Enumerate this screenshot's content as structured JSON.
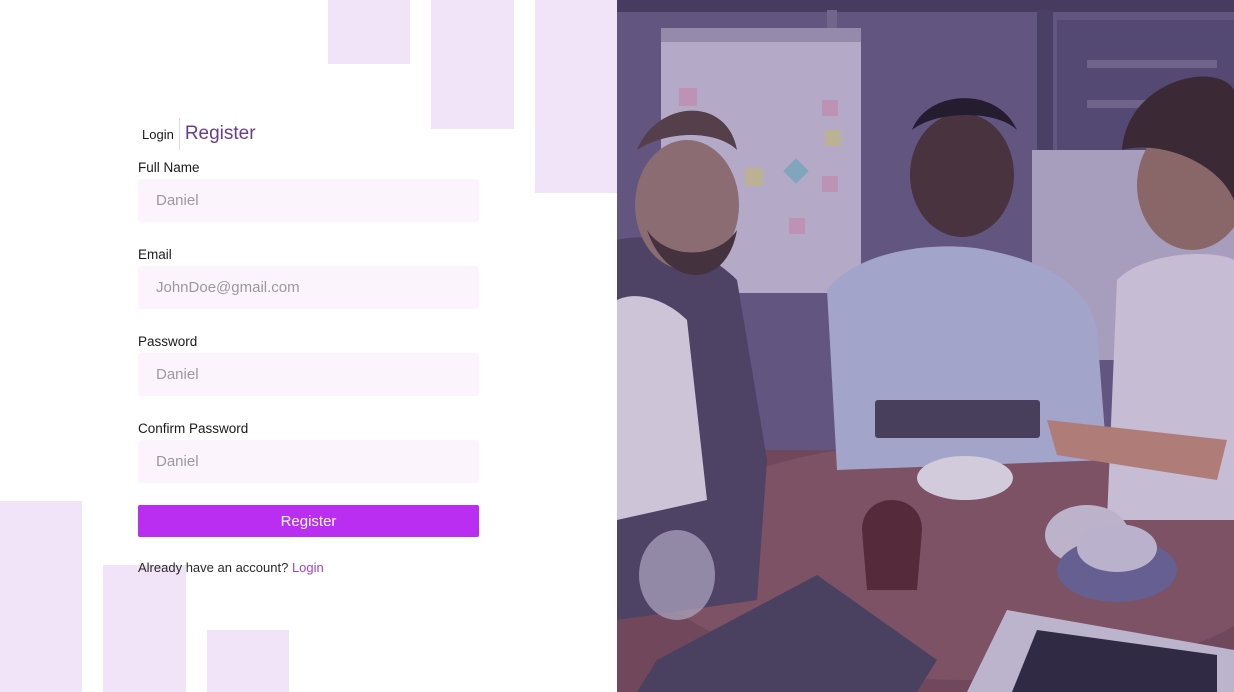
{
  "tabs": {
    "login": "Login",
    "register": "Register"
  },
  "form": {
    "fields": [
      {
        "label": "Full Name",
        "placeholder": "Daniel"
      },
      {
        "label": "Email",
        "placeholder": "JohnDoe@gmail.com"
      },
      {
        "label": "Password",
        "placeholder": "Daniel"
      },
      {
        "label": "Confirm Password",
        "placeholder": "Daniel"
      }
    ],
    "submit_label": "Register"
  },
  "footer": {
    "prompt": "Already have an account?",
    "link": "Login"
  },
  "colors": {
    "accent": "#b92ef0",
    "link": "#a23fd4",
    "input_bg": "#fbf4fd",
    "deco": "#f1e4f8",
    "photo_overlay": "#5a4f76"
  }
}
